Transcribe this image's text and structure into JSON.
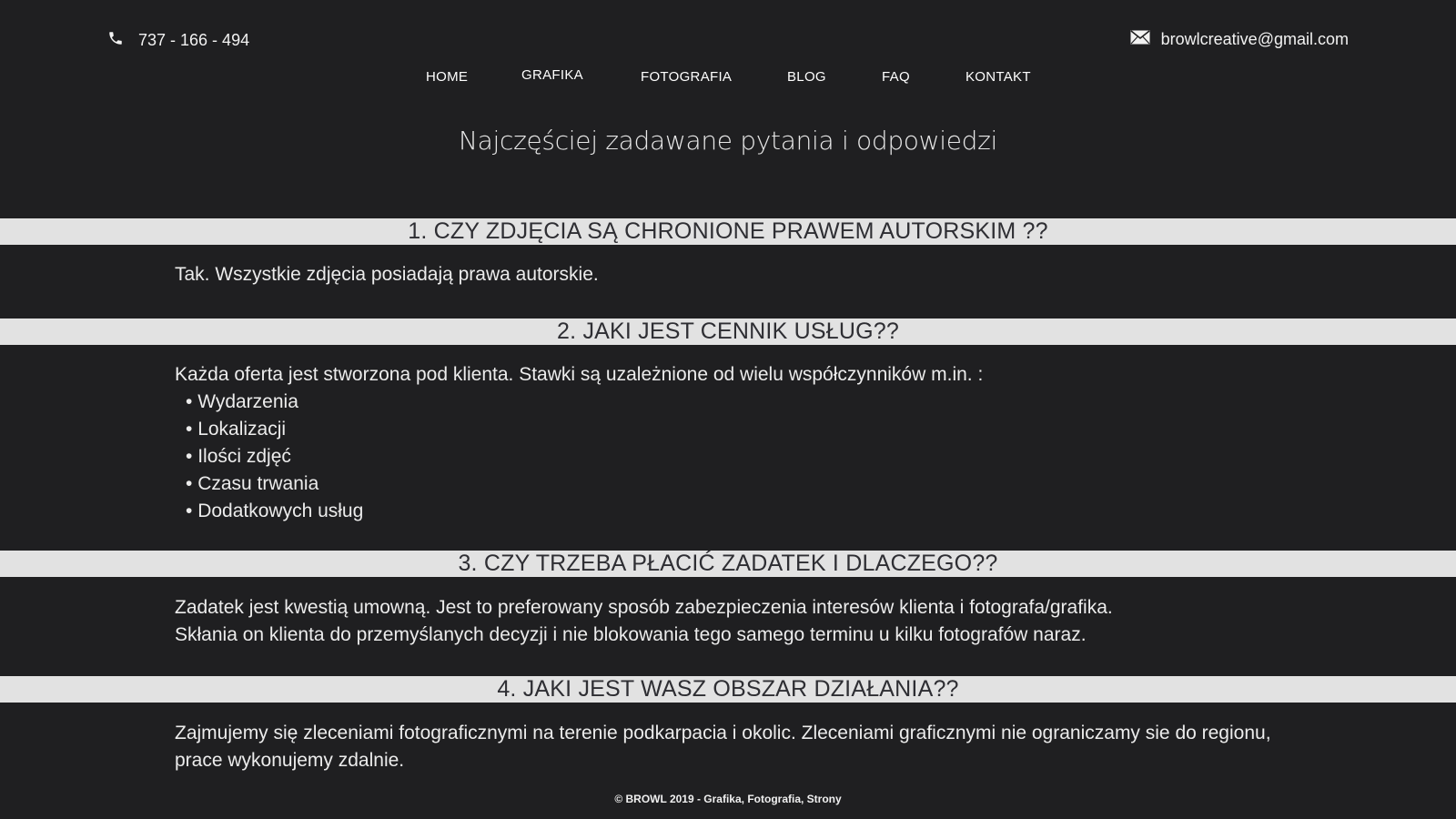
{
  "contact": {
    "phone": "737 - 166 - 494",
    "email": "browlcreative@gmail.com",
    "phone_icon": "phone-icon",
    "email_icon": "envelope-icon"
  },
  "nav": {
    "items": [
      {
        "label": "HOME"
      },
      {
        "label": "GRAFIKA"
      },
      {
        "label": "FOTOGRAFIA"
      },
      {
        "label": "BLOG"
      },
      {
        "label": "FAQ"
      },
      {
        "label": "KONTAKT"
      }
    ]
  },
  "page": {
    "title": "Najczęściej zadawane pytania i odpowiedzi"
  },
  "faq": [
    {
      "question": "1. CZY ZDJĘCIA SĄ CHRONIONE PRAWEM AUTORSKIM ??",
      "answer": "Tak. Wszystkie zdjęcia posiadają prawa autorskie."
    },
    {
      "question": "2. JAKI JEST CENNIK USŁUG??",
      "answer": "Każda oferta jest stworzona pod klienta. Stawki są uzależnione od wielu współczynników m.in. :",
      "bullets": [
        "Wydarzenia",
        "Lokalizacji",
        "Ilości zdjęć",
        "Czasu trwania",
        "Dodatkowych usług"
      ]
    },
    {
      "question": "3. CZY TRZEBA PŁACIĆ ZADATEK I DLACZEGO??",
      "answer_line1": "Zadatek jest kwestią umowną. Jest to preferowany sposób zabezpieczenia interesów klienta i fotografa/grafika.",
      "answer_line2": "Skłania on klienta do przemyślanych decyzji i nie blokowania tego samego terminu u kilku fotografów naraz."
    },
    {
      "question": "4. JAKI JEST WASZ OBSZAR DZIAŁANIA??",
      "answer": "Zajmujemy się zleceniami fotograficznymi na terenie podkarpacia i okolic. Zleceniami graficznymi nie ograniczamy sie do regionu, prace wykonujemy zdalnie."
    }
  ],
  "footer": {
    "text": "©  BROWL 2019 - Grafika, Fotografia, Strony"
  },
  "colors": {
    "background": "#1f1f21",
    "question_bar": "#e2e2e2",
    "question_text": "#2e2e33"
  }
}
